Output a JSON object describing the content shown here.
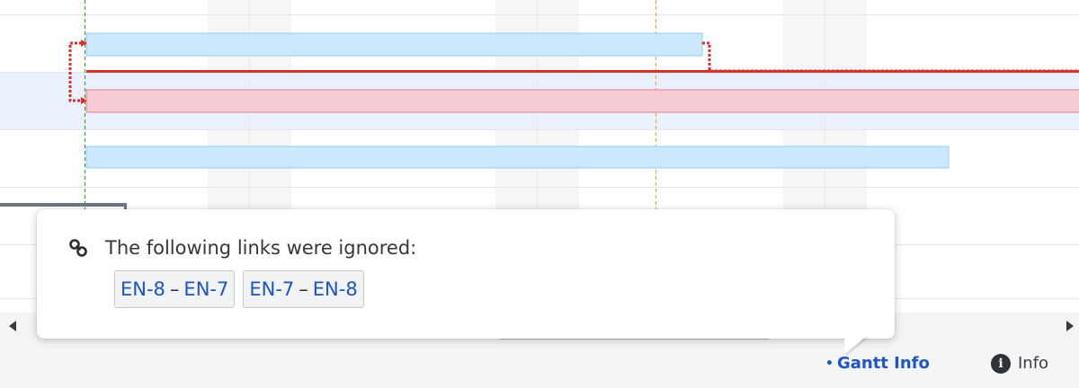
{
  "gantt": {
    "colors": {
      "bar_blue_fill": "#cce8fd",
      "bar_blue_stroke": "#93ccf5",
      "bar_red_fill": "#f8ccd4",
      "bar_red_stroke": "#e67b8f",
      "link_red": "#d8302d",
      "today_line": "#3fa33b",
      "marker_line": "#f5a043",
      "highlight_row": "#eaf1fd",
      "weekend_column": "#f5f6f8"
    }
  },
  "popover": {
    "message": "The following links were ignored:",
    "link_icon": "link-icon",
    "links": [
      {
        "from": "EN-8",
        "separator": "–",
        "to": "EN-7"
      },
      {
        "from": "EN-7",
        "separator": "–",
        "to": "EN-8"
      }
    ]
  },
  "footer": {
    "gantt_info_bullet": "•",
    "gantt_info_label": "Gantt Info",
    "info_icon": "info-icon",
    "info_glyph": "i",
    "info_label": "Info"
  }
}
